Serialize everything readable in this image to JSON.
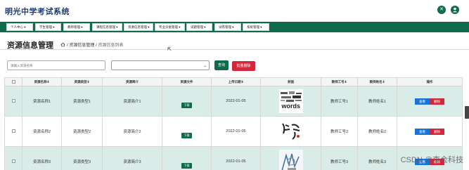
{
  "app": {
    "title": "明光中学考试系统"
  },
  "header_icons": [
    {
      "name": "close-circle-icon",
      "glyph": "✕"
    },
    {
      "name": "user-icon",
      "glyph": "👤"
    }
  ],
  "nav": [
    "个人中心",
    "学生管理",
    "教师管理",
    "课程信息管理",
    "资源信息管理",
    "专业分类管理",
    "试题管理",
    "试卷管理",
    "系统管理"
  ],
  "page": {
    "title": "资源信息管理",
    "breadcrumb": [
      "资源信息管理",
      "资源信息列表"
    ]
  },
  "toolbar": {
    "search_placeholder": "请输入资源名称",
    "select_value": "",
    "query_label": "查询",
    "batch_delete_label": "批量删除"
  },
  "table": {
    "headers": [
      "",
      "资源名称",
      "资源类型",
      "资源简介",
      "资源文件",
      "上传日期",
      "封面",
      "教师工号",
      "教师姓名",
      "操作"
    ],
    "download_label": "下载",
    "view_label": "查看",
    "delete_label": "删除",
    "rows": [
      {
        "name": "资源名称1",
        "type": "资源类型1",
        "intro": "资源简介1",
        "date": "2022-01-05",
        "teacher_no": "教师工号1",
        "teacher_name": "教师姓名1",
        "cover_text": "words"
      },
      {
        "name": "资源名称2",
        "type": "资源类型2",
        "intro": "资源简介2",
        "date": "2022-01-05",
        "teacher_no": "教师工号2",
        "teacher_name": "教师姓名2",
        "cover_text": ""
      },
      {
        "name": "资源名称3",
        "type": "资源类型3",
        "intro": "资源简介3",
        "date": "2022-01-05",
        "teacher_no": "教师工号3",
        "teacher_name": "教师姓名3",
        "cover_text": ""
      }
    ]
  },
  "watermark": "CSDN @李会科技",
  "colors": {
    "primary": "#0f6b4a",
    "danger": "#d6263a",
    "info": "#1a73d9",
    "row_alt": "#d9ece8",
    "title": "#1b3a7a"
  }
}
